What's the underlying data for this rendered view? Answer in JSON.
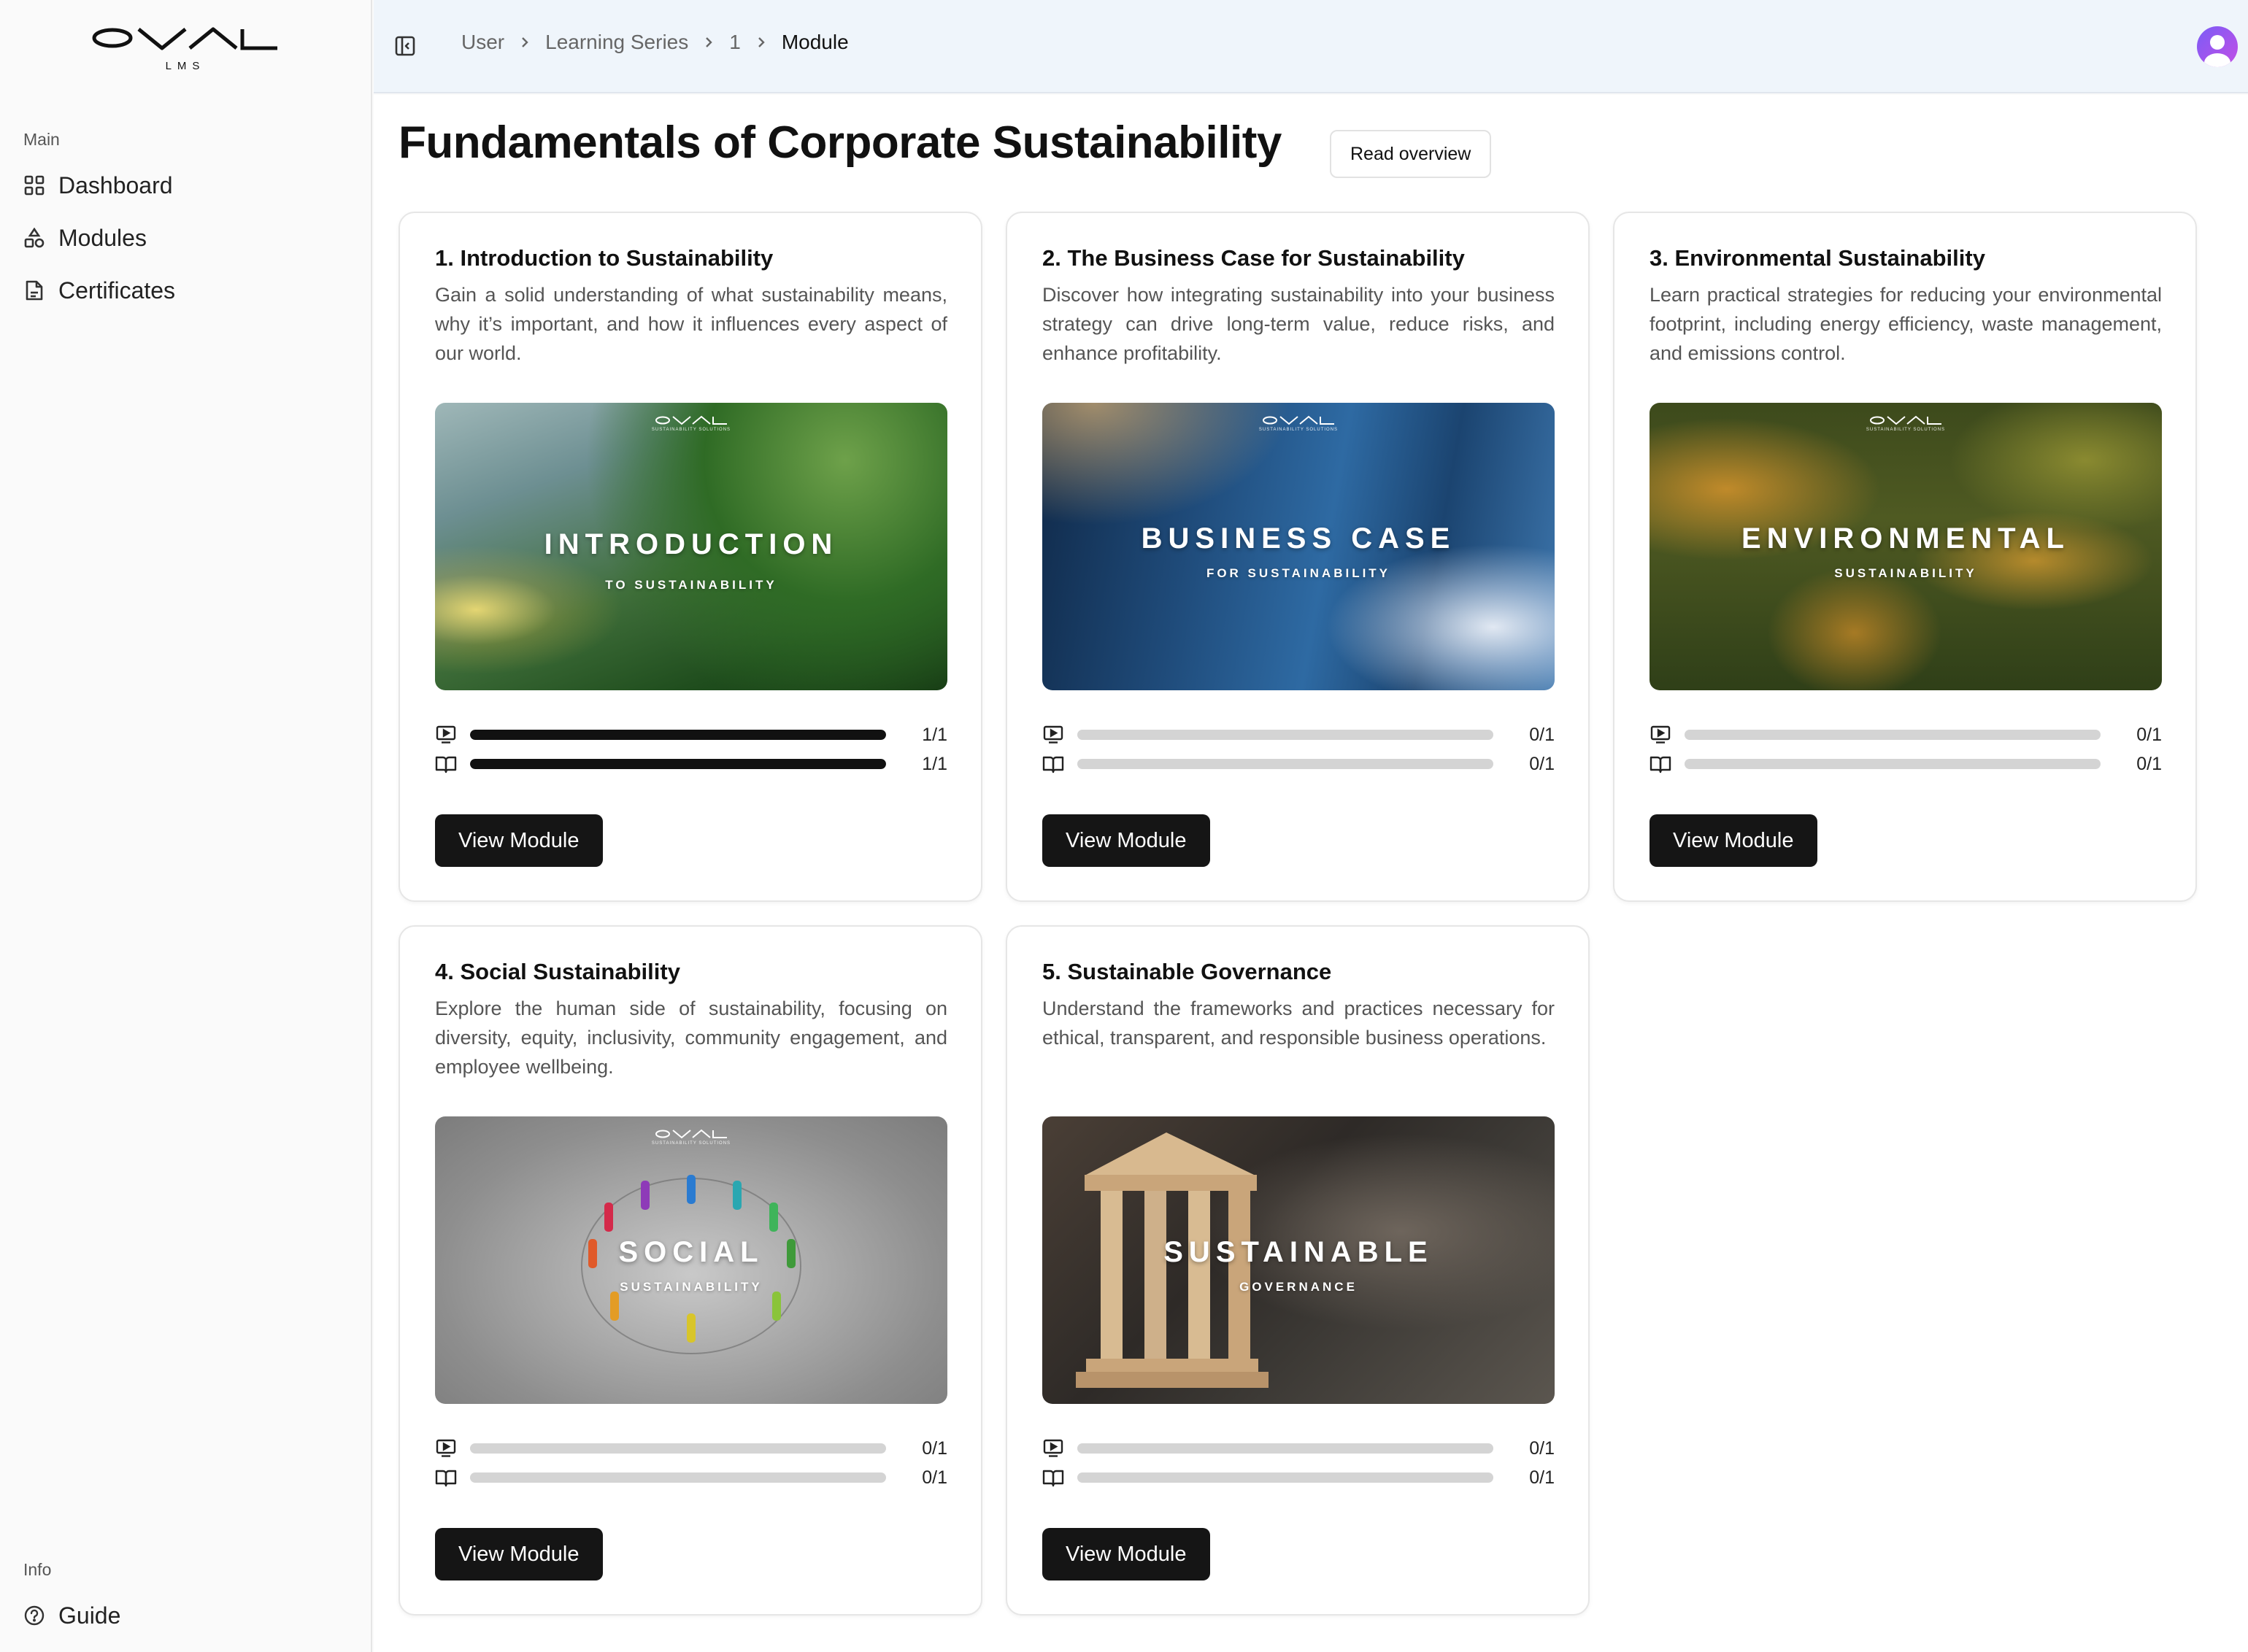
{
  "app": {
    "logo_text": "OVAL",
    "logo_sub": "LMS"
  },
  "sidebar": {
    "main_label": "Main",
    "items": [
      {
        "label": "Dashboard",
        "icon": "grid-icon"
      },
      {
        "label": "Modules",
        "icon": "shapes-icon"
      },
      {
        "label": "Certificates",
        "icon": "document-icon"
      }
    ],
    "info_label": "Info",
    "guide": {
      "label": "Guide",
      "icon": "help-circle-icon"
    }
  },
  "breadcrumb": [
    "User",
    "Learning Series",
    "1",
    "Module"
  ],
  "page": {
    "title": "Fundamentals of Corporate Sustainability",
    "overview_button": "Read overview"
  },
  "thumb_brand": "OVAL",
  "thumb_brand_sub": "SUSTAINABILITY SOLUTIONS",
  "modules": [
    {
      "title": "1. Introduction to Sustainability",
      "description": "Gain a solid understanding of what sustainability means, why it’s important, and how it influences every aspect of our world.",
      "thumb_title": "INTRODUCTION",
      "thumb_subtitle": "TO SUSTAINABILITY",
      "video_progress": 1.0,
      "video_count": "1/1",
      "reading_progress": 1.0,
      "reading_count": "1/1",
      "button": "View Module"
    },
    {
      "title": "2. The Business Case for Sustainability",
      "description": "Discover how integrating sustainability into your business strategy can drive long-term value, reduce risks, and enhance profitability.",
      "thumb_title": "BUSINESS CASE",
      "thumb_subtitle": "FOR SUSTAINABILITY",
      "video_progress": 0.0,
      "video_count": "0/1",
      "reading_progress": 0.0,
      "reading_count": "0/1",
      "button": "View Module"
    },
    {
      "title": "3. Environmental Sustainability",
      "description": "Learn practical strategies for reducing your environmental footprint, including energy efficiency, waste management, and emissions control.",
      "thumb_title": "ENVIRONMENTAL",
      "thumb_subtitle": "SUSTAINABILITY",
      "video_progress": 0.0,
      "video_count": "0/1",
      "reading_progress": 0.0,
      "reading_count": "0/1",
      "button": "View Module"
    },
    {
      "title": "4. Social Sustainability",
      "description": "Explore the human side of sustainability, focusing on diversity, equity, inclusivity, community engagement, and employee wellbeing.",
      "thumb_title": "SOCIAL",
      "thumb_subtitle": "SUSTAINABILITY",
      "video_progress": 0.0,
      "video_count": "0/1",
      "reading_progress": 0.0,
      "reading_count": "0/1",
      "button": "View Module"
    },
    {
      "title": "5. Sustainable Governance",
      "description": "Understand the frameworks and practices necessary for ethical, transparent, and responsible business operations.",
      "thumb_title": "SUSTAINABLE",
      "thumb_subtitle": "GOVERNANCE",
      "video_progress": 0.0,
      "video_count": "0/1",
      "reading_progress": 0.0,
      "reading_count": "0/1",
      "button": "View Module"
    }
  ],
  "colors": {
    "primary_button": "#151515",
    "progress_fill": "#111111",
    "progress_track": "#d4d4d4",
    "header_bg": "#eff5fb",
    "avatar": "#7b5cf6"
  }
}
